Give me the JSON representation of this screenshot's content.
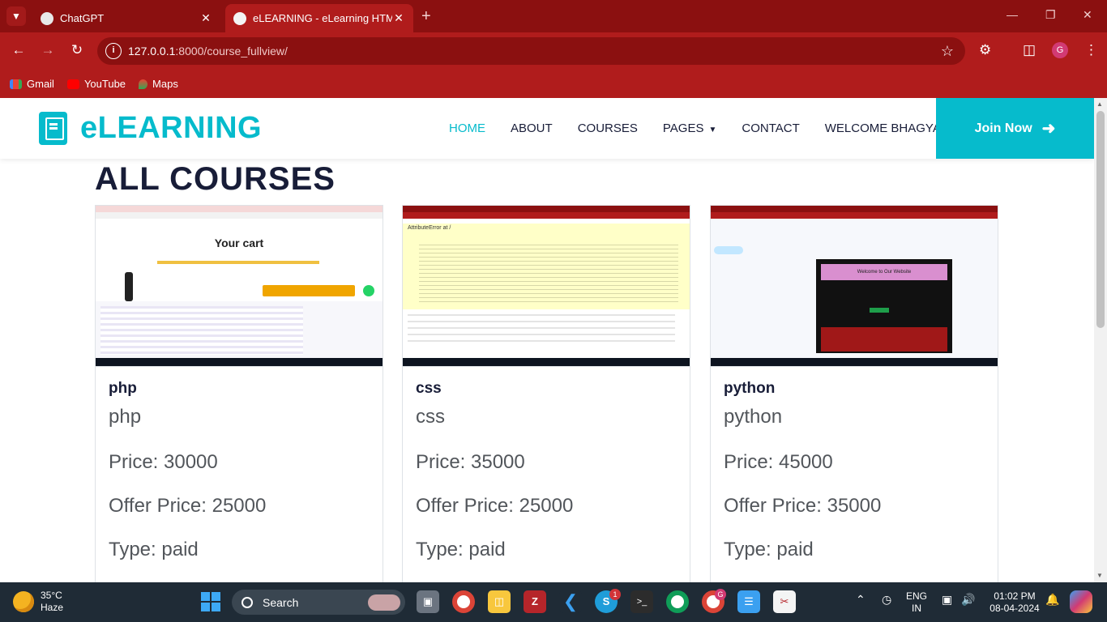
{
  "browser": {
    "tabs": [
      {
        "title": "ChatGPT",
        "active": false
      },
      {
        "title": "eLEARNING - eLearning HTML",
        "active": true
      }
    ],
    "url_host": "127.0.0.1",
    "url_path": ":8000/course_fullview/",
    "profile_initial": "G",
    "bookmarks": [
      "Gmail",
      "YouTube",
      "Maps"
    ]
  },
  "site": {
    "logo": "eLEARNING",
    "menu": [
      "HOME",
      "ABOUT",
      "COURSES",
      "PAGES",
      "CONTACT",
      "WELCOME BHAGYA"
    ],
    "join_label": "Join Now",
    "page_title": "ALL COURSES"
  },
  "courses": [
    {
      "name": "php",
      "description": "php",
      "price": "Price: 30000",
      "offer": "Offer Price: 25000",
      "type": "Type: paid",
      "thumb_text": "Your cart"
    },
    {
      "name": "css",
      "description": "css",
      "price": "Price: 35000",
      "offer": "Offer Price: 25000",
      "type": "Type: paid",
      "thumb_text": "AttributeError at /"
    },
    {
      "name": "python",
      "description": "python",
      "price": "Price: 45000",
      "offer": "Offer Price: 35000",
      "type": "Type: paid",
      "thumb_text": "Welcome to Our Website"
    }
  ],
  "taskbar": {
    "temperature": "35°C",
    "weather": "Haze",
    "search_label": "Search",
    "lang_top": "ENG",
    "lang_bottom": "IN",
    "time": "01:02 PM",
    "date": "08-04-2024",
    "skype_badge": "1",
    "chrome_badge": "G"
  },
  "colors": {
    "brand": "#06bbcc",
    "chrome_dark": "#8b1010",
    "chrome": "#b01c1c",
    "heading": "#181d38",
    "text": "#52565b"
  }
}
